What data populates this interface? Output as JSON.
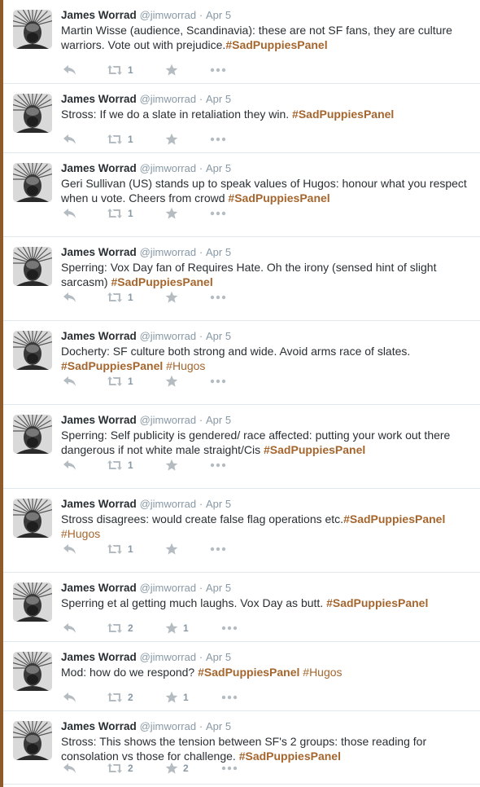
{
  "colors": {
    "accent": "#a5662e",
    "meta": "#8899a6",
    "icon": "#b4bcc2",
    "divider": "#e1e8ed"
  },
  "icons": {
    "reply": "reply-icon",
    "retweet": "retweet-icon",
    "favorite": "star-icon",
    "more": "more-icon"
  },
  "tweets": [
    {
      "name": "James Worrad",
      "handle": "@jimworrad",
      "dot": "·",
      "date": "Apr 5",
      "text": "Martin Wisse (audience, Scandinavia): these are not SF fans, they are culture warriors. Vote out with prejudice.",
      "tags": [
        "#SadPuppiesPanel"
      ],
      "retweets": "1",
      "favorites": ""
    },
    {
      "name": "James Worrad",
      "handle": "@jimworrad",
      "dot": "·",
      "date": "Apr 5",
      "text": "Stross: If we do a slate in retaliation they win. ",
      "tags": [
        "#SadPuppiesPanel"
      ],
      "retweets": "1",
      "favorites": ""
    },
    {
      "name": "James Worrad",
      "handle": "@jimworrad",
      "dot": "·",
      "date": "Apr 5",
      "text": "Geri Sullivan (US) stands up to speak values of Hugos: honour what you respect when u vote. Cheers from crowd ",
      "tags": [
        "#SadPuppiesPanel"
      ],
      "retweets": "1",
      "favorites": ""
    },
    {
      "name": "James Worrad",
      "handle": "@jimworrad",
      "dot": "·",
      "date": "Apr 5",
      "text": "Sperring: Vox Day fan of Requires Hate. Oh the irony (sensed hint of slight sarcasm) ",
      "tags": [
        "#SadPuppiesPanel"
      ],
      "retweets": "1",
      "favorites": ""
    },
    {
      "name": "James Worrad",
      "handle": "@jimworrad",
      "dot": "·",
      "date": "Apr 5",
      "text": "Docherty: SF culture both strong and wide. Avoid arms race of slates. ",
      "tags": [
        "#SadPuppiesPanel",
        "#Hugos"
      ],
      "retweets": "1",
      "favorites": ""
    },
    {
      "name": "James Worrad",
      "handle": "@jimworrad",
      "dot": "·",
      "date": "Apr 5",
      "text": "Sperring: Self publicity is gendered/ race affected: putting your work out there dangerous if not white male straight/Cis ",
      "tags": [
        "#SadPuppiesPanel"
      ],
      "retweets": "1",
      "favorites": ""
    },
    {
      "name": "James Worrad",
      "handle": "@jimworrad",
      "dot": "·",
      "date": "Apr 5",
      "text": "Stross disagrees: would create false flag operations etc.",
      "tags": [
        "#SadPuppiesPanel",
        "#Hugos"
      ],
      "retweets": "1",
      "favorites": ""
    },
    {
      "name": "James Worrad",
      "handle": "@jimworrad",
      "dot": "·",
      "date": "Apr 5",
      "text": "Sperring et al getting much laughs. Vox Day as butt. ",
      "tags": [
        "#SadPuppiesPanel"
      ],
      "retweets": "2",
      "favorites": "1"
    },
    {
      "name": "James Worrad",
      "handle": "@jimworrad",
      "dot": "·",
      "date": "Apr 5",
      "text": "Mod: how do we respond? ",
      "tags": [
        "#SadPuppiesPanel",
        "#Hugos"
      ],
      "retweets": "2",
      "favorites": "1"
    },
    {
      "name": "James Worrad",
      "handle": "@jimworrad",
      "dot": "·",
      "date": "Apr 5",
      "text": "Stross: This shows the tension between SF's 2 groups: those reading for consolation vs those for challenge. ",
      "tags": [
        "#SadPuppiesPanel"
      ],
      "retweets": "2",
      "favorites": "2"
    }
  ]
}
